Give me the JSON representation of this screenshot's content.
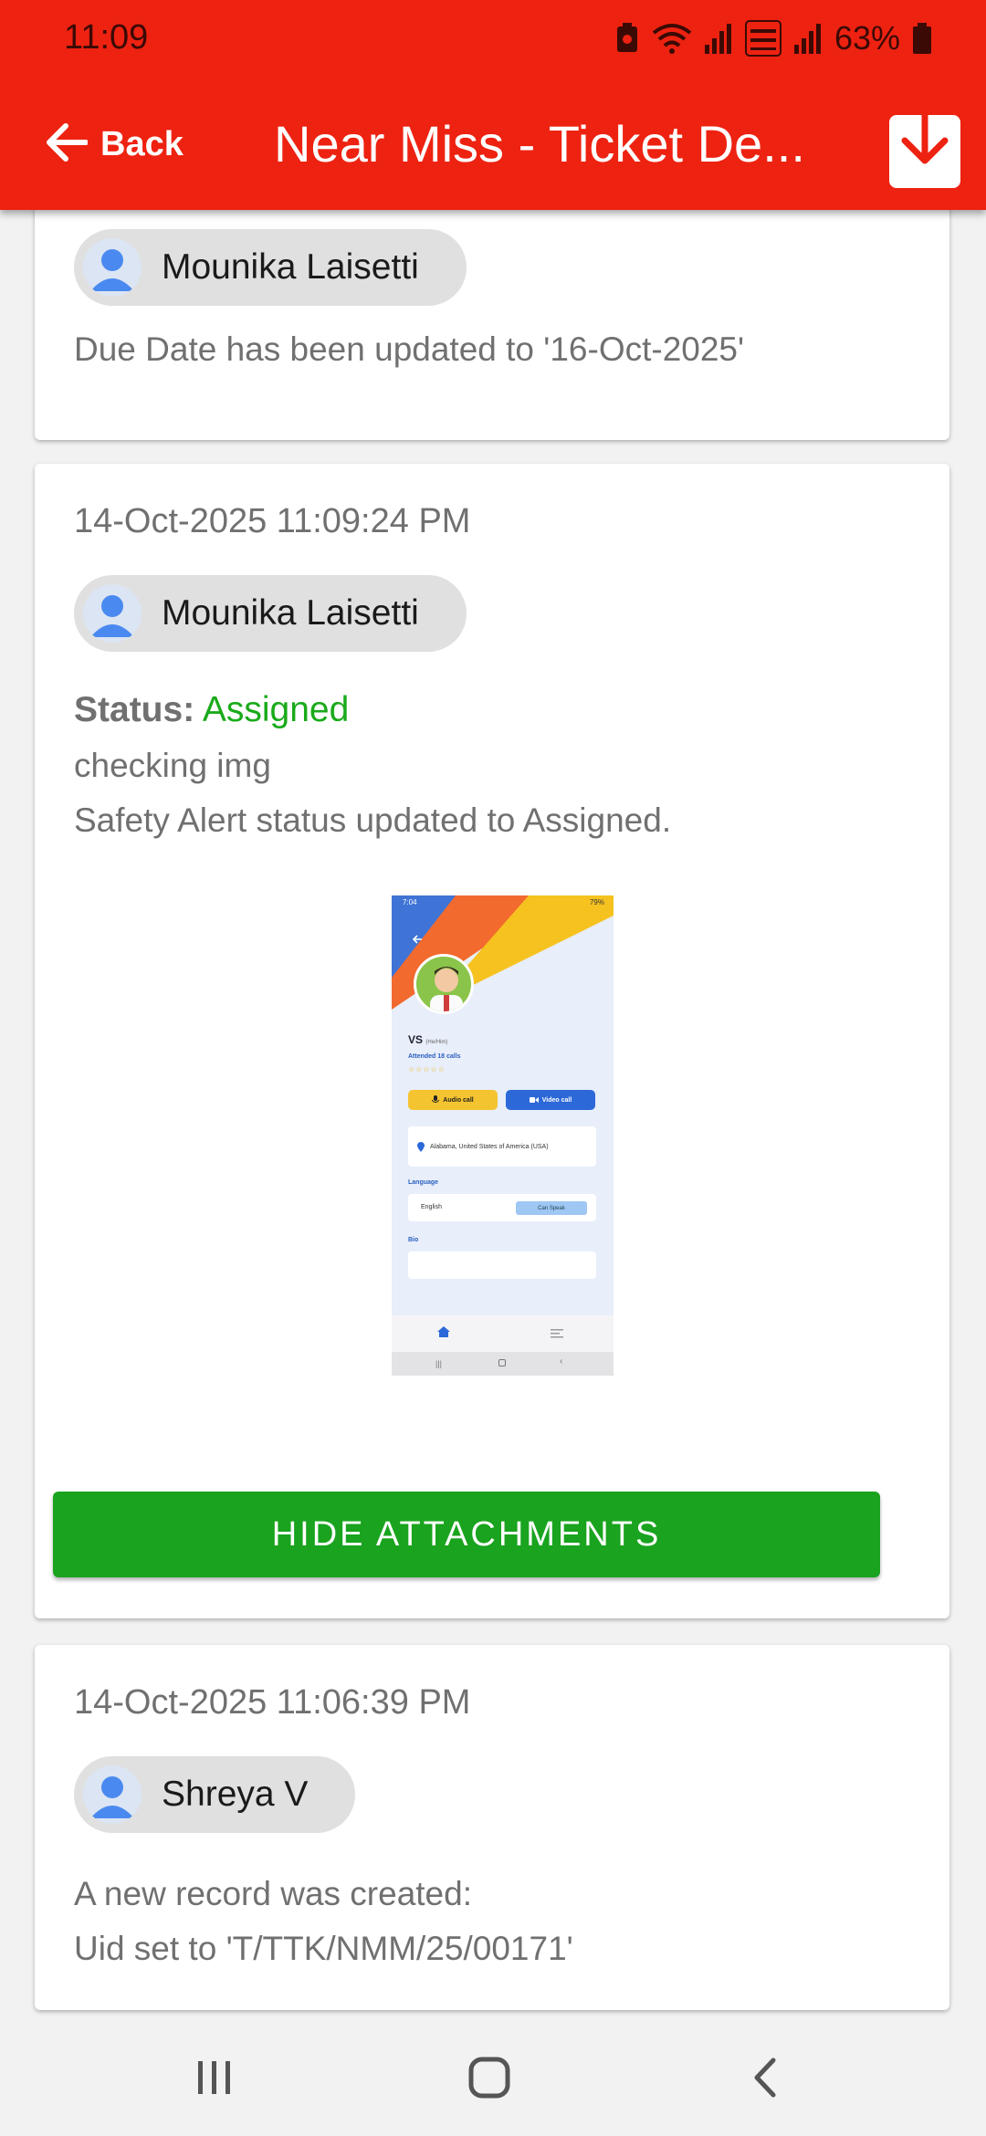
{
  "status_bar": {
    "time": "11:09",
    "battery": "63%"
  },
  "header": {
    "back_label": "Back",
    "title": "Near Miss - Ticket De...",
    "download_icon": "download-icon"
  },
  "timeline": [
    {
      "user": "Mounika Laisetti",
      "lines": [
        "Due Date has been updated to '16-Oct-2025'"
      ]
    },
    {
      "date": "14-Oct-2025 11:09:24 PM",
      "user": "Mounika Laisetti",
      "status_label": "Status:",
      "status_value": "Assigned",
      "lines": [
        "checking img",
        "Safety Alert status updated to Assigned."
      ],
      "attachment": {
        "status_time": "7:04",
        "status_battery": "79%",
        "name": "VS",
        "name_sub": "(He/Him)",
        "attended": "Attended 18 calls",
        "audio_label": "Audio call",
        "video_label": "Video call",
        "location": "Alabama, United States of America (USA)",
        "language_heading": "Language",
        "language": "English",
        "language_level": "Can Speak",
        "bio_heading": "Bio"
      },
      "hide_button": "HIDE ATTACHMENTS"
    },
    {
      "date": "14-Oct-2025 11:06:39 PM",
      "user": "Shreya V",
      "lines": [
        "A new record was created:",
        "Uid set to 'T/TTK/NMM/25/00171'"
      ]
    }
  ],
  "colors": {
    "header": "#ee2211",
    "status_assigned": "#1aaa1a",
    "hide_button": "#19a31e"
  }
}
